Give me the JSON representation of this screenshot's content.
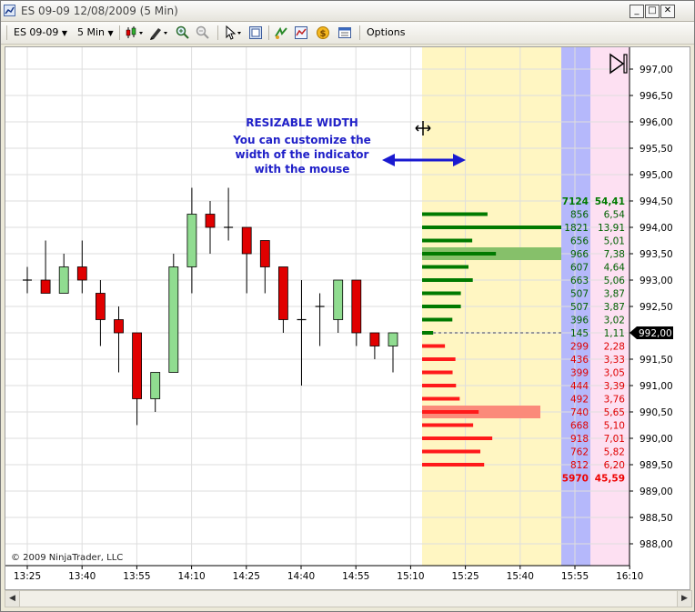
{
  "window": {
    "title": "ES 09-09  12/08/2009 (5 Min)",
    "controls": [
      "_",
      "□",
      "✕"
    ]
  },
  "toolbar": {
    "instrument": "ES 09-09",
    "interval": "5 Min",
    "options_label": "Options"
  },
  "annotation": {
    "line1": "RESIZABLE WIDTH",
    "line2": "You can customize the",
    "line3": "width of the indicator",
    "line4": "with the mouse"
  },
  "copyright": "© 2009 NinjaTrader, LLC",
  "current_price_label": "992,00",
  "colors": {
    "up_candle": "#90dc90",
    "down_candle": "#e00000",
    "volume_up": "#007a00",
    "volume_down": "#ff1a1a",
    "zone_yellow": "#fff6c2",
    "zone_blue": "#b5b8fb",
    "zone_pink": "#fde0f2",
    "annotation": "#2020c8"
  },
  "chart_data": {
    "type": "candlestick",
    "title": "",
    "xlabel": "",
    "ylabel": "",
    "ylim": [
      987.8,
      997.3
    ],
    "x_ticks": [
      "13:25",
      "13:40",
      "13:55",
      "14:10",
      "14:25",
      "14:40",
      "14:55",
      "15:10",
      "15:25",
      "15:40",
      "15:55",
      "16:10"
    ],
    "y_ticks": [
      "997,00",
      "996,50",
      "996,00",
      "995,50",
      "995,00",
      "994,50",
      "994,00",
      "993,50",
      "993,00",
      "992,50",
      "992,00",
      "991,50",
      "991,00",
      "990,50",
      "990,00",
      "989,50",
      "989,00",
      "988,50",
      "988,00"
    ],
    "y_tick_values": [
      997,
      996.5,
      996,
      995.5,
      995,
      994.5,
      994,
      993.5,
      993,
      992.5,
      992,
      991.5,
      991,
      990.5,
      990,
      989.5,
      989,
      988.5,
      988
    ],
    "candles": [
      {
        "o": 993.0,
        "h": 993.25,
        "l": 992.75,
        "c": 993.0
      },
      {
        "o": 993.0,
        "h": 993.75,
        "l": 992.75,
        "c": 992.75
      },
      {
        "o": 992.75,
        "h": 993.5,
        "l": 992.75,
        "c": 993.25
      },
      {
        "o": 993.25,
        "h": 993.75,
        "l": 992.75,
        "c": 993.0
      },
      {
        "o": 992.75,
        "h": 993.0,
        "l": 991.75,
        "c": 992.25
      },
      {
        "o": 992.25,
        "h": 992.5,
        "l": 991.25,
        "c": 992.0
      },
      {
        "o": 992.0,
        "h": 992.0,
        "l": 990.25,
        "c": 990.75
      },
      {
        "o": 990.75,
        "h": 991.25,
        "l": 990.5,
        "c": 991.25
      },
      {
        "o": 991.25,
        "h": 993.5,
        "l": 991.25,
        "c": 993.25
      },
      {
        "o": 993.25,
        "h": 994.75,
        "l": 992.75,
        "c": 994.25
      },
      {
        "o": 994.25,
        "h": 994.5,
        "l": 993.5,
        "c": 994.0
      },
      {
        "o": 994.0,
        "h": 994.75,
        "l": 993.75,
        "c": 994.0
      },
      {
        "o": 994.0,
        "h": 994.0,
        "l": 992.75,
        "c": 993.5
      },
      {
        "o": 993.75,
        "h": 993.75,
        "l": 992.75,
        "c": 993.25
      },
      {
        "o": 993.25,
        "h": 993.25,
        "l": 992.0,
        "c": 992.25
      },
      {
        "o": 992.25,
        "h": 993.0,
        "l": 991.0,
        "c": 992.25
      },
      {
        "o": 992.5,
        "h": 992.75,
        "l": 991.75,
        "c": 992.5
      },
      {
        "o": 992.25,
        "h": 993.0,
        "l": 992.0,
        "c": 993.0
      },
      {
        "o": 993.0,
        "h": 993.0,
        "l": 991.75,
        "c": 992.0
      },
      {
        "o": 992.0,
        "h": 992.0,
        "l": 991.5,
        "c": 991.75
      },
      {
        "o": 991.75,
        "h": 992.0,
        "l": 991.25,
        "c": 992.0
      }
    ],
    "volume_profile": {
      "totals_up": {
        "volume": "7124",
        "percent": "54,41",
        "price": 994.5
      },
      "totals_down": {
        "volume": "5970",
        "percent": "45,59",
        "price": 989.25
      },
      "levels": [
        {
          "price": 994.25,
          "volume": "856",
          "percent": "6,54",
          "side": "up"
        },
        {
          "price": 994.0,
          "volume": "1821",
          "percent": "13,91",
          "side": "up"
        },
        {
          "price": 993.75,
          "volume": "656",
          "percent": "5,01",
          "side": "up"
        },
        {
          "price": 993.5,
          "volume": "966",
          "percent": "7,38",
          "side": "up"
        },
        {
          "price": 993.25,
          "volume": "607",
          "percent": "4,64",
          "side": "up"
        },
        {
          "price": 993.0,
          "volume": "663",
          "percent": "5,06",
          "side": "up"
        },
        {
          "price": 992.75,
          "volume": "507",
          "percent": "3,87",
          "side": "up"
        },
        {
          "price": 992.5,
          "volume": "507",
          "percent": "3,87",
          "side": "up"
        },
        {
          "price": 992.25,
          "volume": "396",
          "percent": "3,02",
          "side": "up"
        },
        {
          "price": 992.0,
          "volume": "145",
          "percent": "1,11",
          "side": "up"
        },
        {
          "price": 991.75,
          "volume": "299",
          "percent": "2,28",
          "side": "down"
        },
        {
          "price": 991.5,
          "volume": "436",
          "percent": "3,33",
          "side": "down"
        },
        {
          "price": 991.25,
          "volume": "399",
          "percent": "3,05",
          "side": "down"
        },
        {
          "price": 991.0,
          "volume": "444",
          "percent": "3,39",
          "side": "down"
        },
        {
          "price": 990.75,
          "volume": "492",
          "percent": "3,76",
          "side": "down"
        },
        {
          "price": 990.5,
          "volume": "740",
          "percent": "5,65",
          "side": "down"
        },
        {
          "price": 990.25,
          "volume": "668",
          "percent": "5,10",
          "side": "down"
        },
        {
          "price": 990.0,
          "volume": "918",
          "percent": "7,01",
          "side": "down"
        },
        {
          "price": 989.75,
          "volume": "762",
          "percent": "5,82",
          "side": "down"
        },
        {
          "price": 989.5,
          "volume": "812",
          "percent": "6,20",
          "side": "down"
        }
      ],
      "highlight_up_price": 993.5,
      "highlight_down_price": 990.5
    }
  }
}
